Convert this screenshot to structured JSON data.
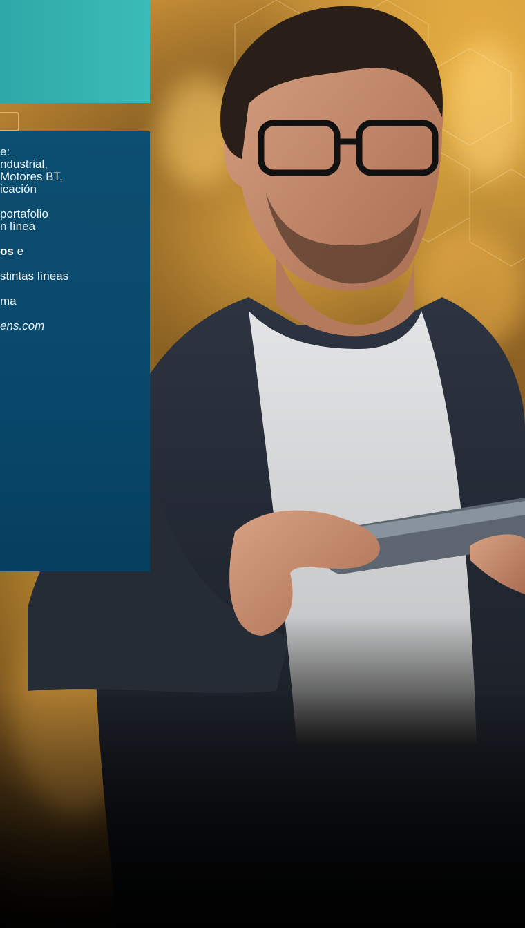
{
  "hero": {
    "image_alt": "Man in glasses and dark blazer holding a tablet in front of a golden digital background"
  },
  "info_panel": {
    "lines": [
      "e:",
      "ndustrial,",
      "Motores BT,",
      "icación",
      "portafolio",
      "n línea",
      "os",
      " e",
      "stintas líneas",
      "ma",
      "ens.com"
    ]
  },
  "colors": {
    "teal": "#3bbcb8",
    "navy": "#0a4a6c"
  }
}
